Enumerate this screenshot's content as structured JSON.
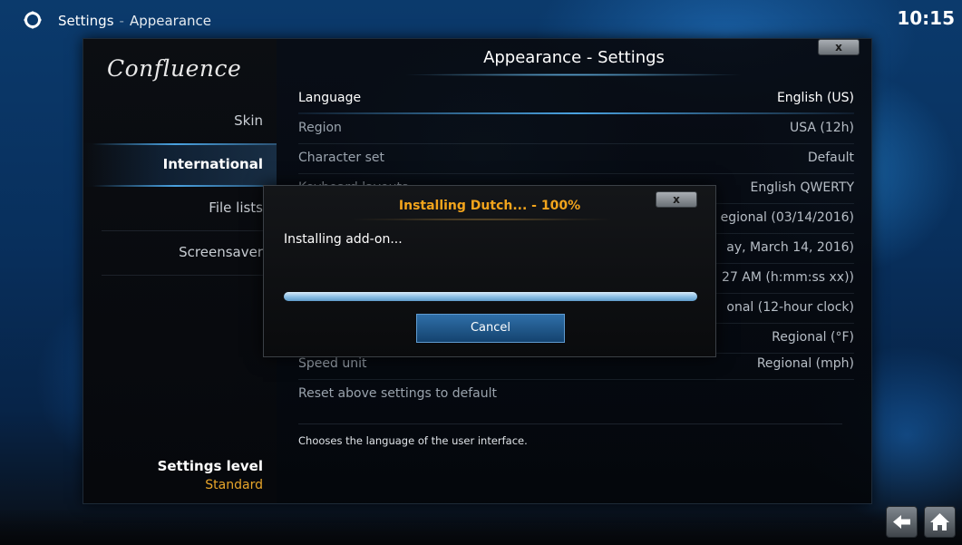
{
  "header": {
    "title": "Settings",
    "separator": "-",
    "subtitle": "Appearance",
    "clock": "10:15",
    "icon": "gear-icon"
  },
  "sidebar": {
    "logo": "Confluence",
    "items": [
      {
        "label": "Skin",
        "active": false
      },
      {
        "label": "International",
        "active": true
      },
      {
        "label": "File lists",
        "active": false
      },
      {
        "label": "Screensaver",
        "active": false
      }
    ],
    "level_title": "Settings level",
    "level_value": "Standard"
  },
  "panel": {
    "title": "Appearance - Settings",
    "close_label": "x",
    "rows": [
      {
        "label": "Language",
        "value": "English (US)"
      },
      {
        "label": "Region",
        "value": "USA (12h)"
      },
      {
        "label": "Character set",
        "value": "Default"
      },
      {
        "label": "Keyboard layouts",
        "value": "English QWERTY"
      },
      {
        "label": "",
        "value": "egional (03/14/2016)"
      },
      {
        "label": "",
        "value": "ay, March 14, 2016)"
      },
      {
        "label": "",
        "value": "27 AM (h:mm:ss xx))"
      },
      {
        "label": "",
        "value": "onal (12-hour clock)"
      },
      {
        "label": "",
        "value": "Regional (°F)"
      },
      {
        "label": "Speed unit",
        "value": "Regional (mph)"
      },
      {
        "label": "Reset above settings to default",
        "value": ""
      }
    ],
    "description": "Chooses the language of the user interface."
  },
  "dialog": {
    "title": "Installing Dutch... - 100%",
    "close_label": "x",
    "message": "Installing add-on...",
    "progress": 1.0,
    "cancel_label": "Cancel"
  },
  "nav": {
    "back_icon": "back-arrow-icon",
    "home_icon": "home-icon"
  },
  "colors": {
    "accent": "#4aa2e0",
    "highlight_orange": "#f2a41c",
    "level_orange": "#e8a52a"
  }
}
